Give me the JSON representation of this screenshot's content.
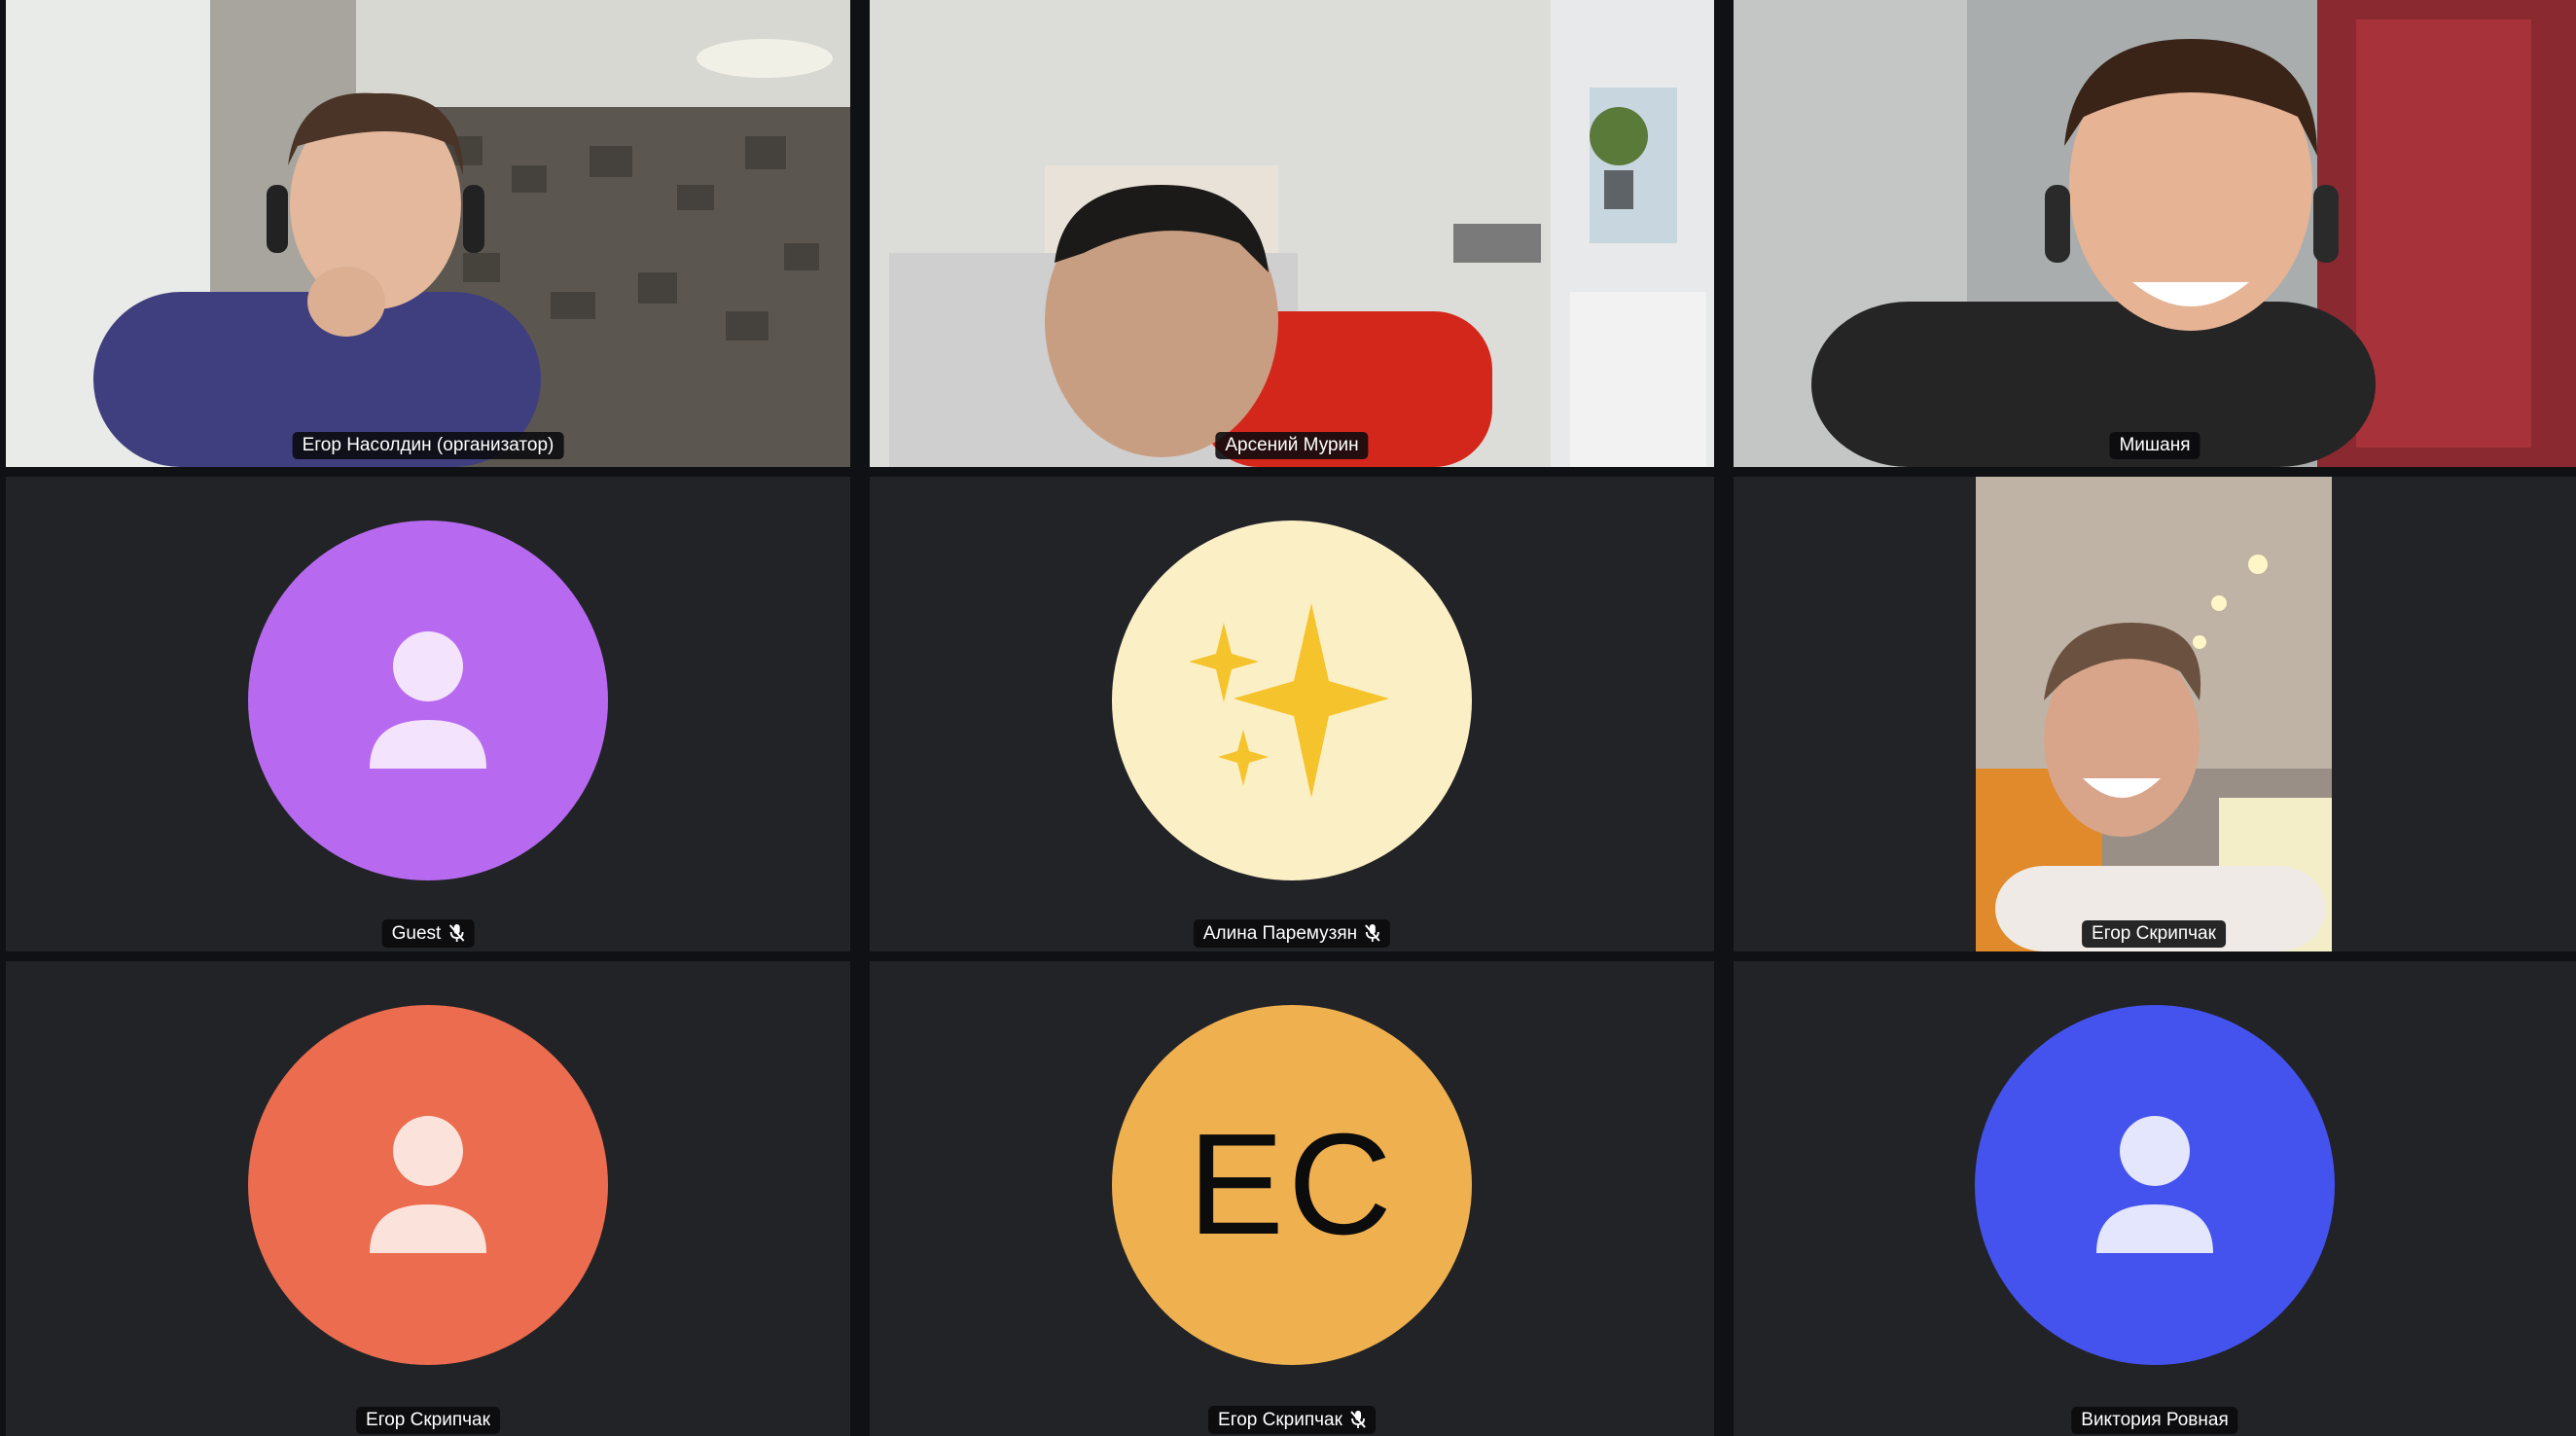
{
  "participants": [
    {
      "name": "Егор Насолдин (организатор)",
      "type": "video",
      "muted": false
    },
    {
      "name": "Арсений Мурин",
      "type": "video",
      "muted": false
    },
    {
      "name": "Мишаня",
      "type": "video",
      "muted": false
    },
    {
      "name": "Guest",
      "type": "avatar",
      "avatar_icon": "person-icon",
      "avatar_color": "#B76AF0",
      "muted": true
    },
    {
      "name": "Алина Паремузян",
      "type": "avatar",
      "avatar_icon": "sparkles-icon",
      "avatar_color": "#FBEFC6",
      "muted": true
    },
    {
      "name": "Егор Скрипчак",
      "type": "video",
      "muted": false
    },
    {
      "name": "Егор Скрипчак",
      "type": "avatar",
      "avatar_icon": "person-icon",
      "avatar_color": "#EB6C4E",
      "muted": false
    },
    {
      "name": "Егор Скрипчак",
      "type": "avatar",
      "avatar_initials": "ЕС",
      "avatar_color": "#EFB04F",
      "muted": true
    },
    {
      "name": "Виктория Ровная",
      "type": "avatar",
      "avatar_icon": "person-icon",
      "avatar_color": "#4553EE",
      "muted": false
    }
  ],
  "colors": {
    "background": "#101114",
    "tile": "#222327",
    "name_label_bg": "#0A0A0C"
  }
}
